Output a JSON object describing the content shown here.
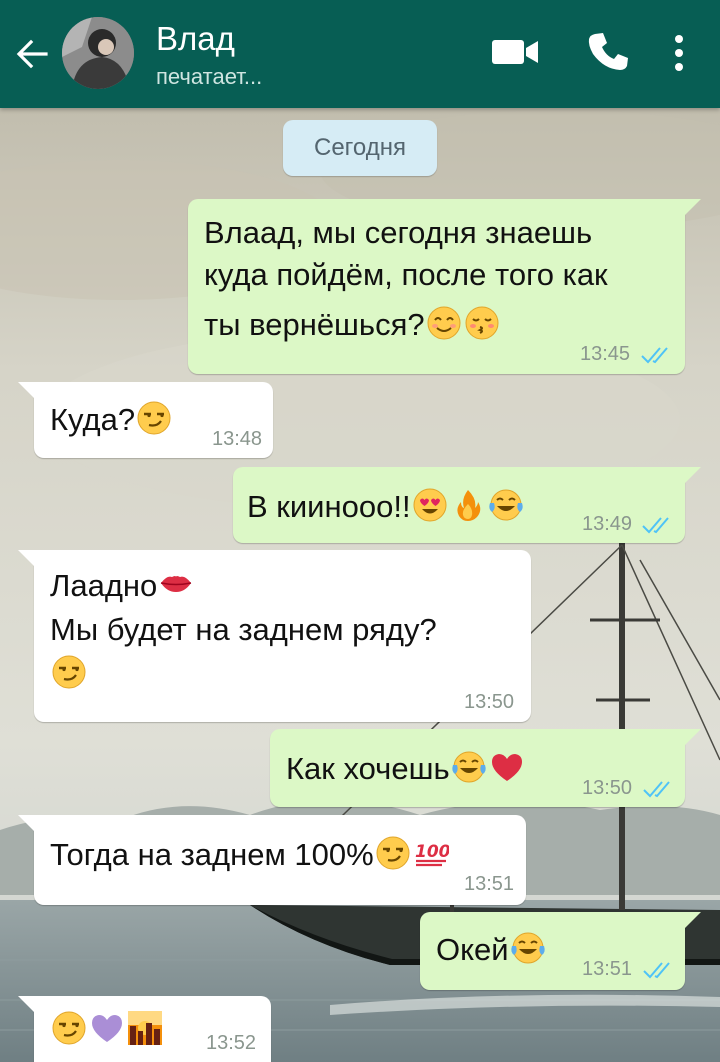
{
  "header": {
    "contact_name": "Влад",
    "status": "печатает..."
  },
  "chat": {
    "date_separator": "Сегодня",
    "messages": [
      {
        "direction": "out",
        "lines": [
          "Влаад, мы сегодня знаешь",
          "куда пойдём, после того как",
          "ты вернёшься?"
        ],
        "emojis": [
          "smiling-face",
          "kissing-face"
        ],
        "time": "13:45",
        "read": true
      },
      {
        "direction": "in",
        "text": "Куда?",
        "emojis": [
          "smirk-face"
        ],
        "time": "13:48"
      },
      {
        "direction": "out",
        "text": "В киинооо!!",
        "emojis": [
          "heart-eyes-face",
          "fire",
          "tears-of-joy-face"
        ],
        "time": "13:49",
        "read": true
      },
      {
        "direction": "in",
        "lines": [
          "Лаадно",
          "Мы будет на заднем ряду?"
        ],
        "emojis": [
          "kiss-lips",
          "smirk-face"
        ],
        "time": "13:50"
      },
      {
        "direction": "out",
        "text": "Как хочешь",
        "emojis": [
          "tears-of-joy-face",
          "red-heart"
        ],
        "time": "13:50",
        "read": true
      },
      {
        "direction": "in",
        "text": "Тогда на заднем 100%",
        "emojis": [
          "smirk-face",
          "hundred-points"
        ],
        "time": "13:51"
      },
      {
        "direction": "out",
        "text": "Окей",
        "emojis": [
          "tears-of-joy-face"
        ],
        "time": "13:51",
        "read": true
      },
      {
        "direction": "in",
        "text": "",
        "emojis": [
          "smirk-face",
          "purple-heart",
          "sunset-city"
        ],
        "time": "13:52"
      }
    ]
  },
  "colors": {
    "header_bg": "#075e54",
    "outgoing_bubble": "#dcf8c6",
    "incoming_bubble": "#ffffff",
    "read_ticks": "#4fc3f7"
  }
}
